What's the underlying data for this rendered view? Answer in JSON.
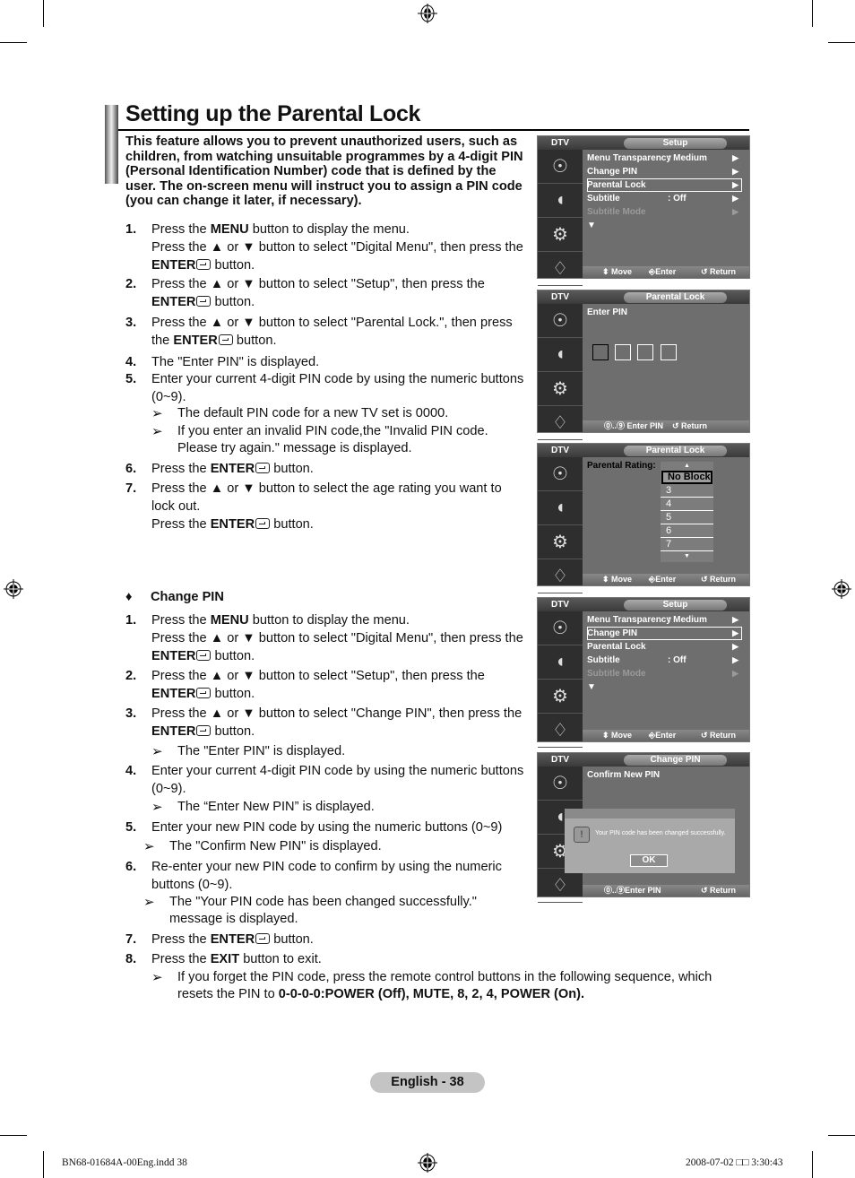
{
  "page": {
    "title": "Setting up the Parental Lock",
    "intro": "This feature allows you to prevent unauthorized users, such as children, from watching unsuitable programmes by a 4-digit PIN (Personal Identification Number) code that is defined by the user. The on-screen menu will instruct you to assign a PIN code (you can change it later, if necessary).",
    "page_label": "English - 38",
    "slug_left": "BN68-01684A-00Eng.indd   38",
    "slug_right": "2008-07-02   □□ 3:30:43"
  },
  "parental_steps": [
    {
      "num": "1.",
      "pre": "Press the ",
      "bold": "MENU",
      "post": " button to display the menu.",
      "line2": "Press the ▲ or ▼ button to select \"Digital Menu\", then press the",
      "enter": "ENTER",
      "tail": " button."
    },
    {
      "num": "2.",
      "line": "Press the ▲ or ▼ button to select \"Setup\", then press the",
      "enter": "ENTER",
      "tail": " button."
    },
    {
      "num": "3.",
      "line": "Press the ▲ or ▼ button to select \"Parental Lock.\", then press",
      "pre2": "the ",
      "enter": "ENTER",
      "tail": " button."
    },
    {
      "num": "4.",
      "line": "The \"Enter PIN\" is displayed."
    },
    {
      "num": "5.",
      "line": "Enter your current 4-digit PIN code by using the numeric buttons",
      "line2": "(0~9)."
    },
    {
      "num": "6.",
      "pre": "Press the ",
      "enter": "ENTER",
      "tail": " button."
    },
    {
      "num": "7.",
      "line": "Press the ▲ or ▼ button to select the age rating you want to",
      "line2": "lock out.",
      "pre3": "Press the ",
      "enter": "ENTER",
      "tail": " button."
    }
  ],
  "parental_notes": [
    "The default PIN code for a new TV set is 0000.",
    "If you enter an invalid PIN code,the \"Invalid PIN code.",
    "Please try again.\" message is displayed."
  ],
  "change_pin": {
    "bullet": "♦",
    "heading": "Change PIN",
    "steps": [
      {
        "num": "1.",
        "pre": "Press the ",
        "bold": "MENU",
        "post": " button to display the menu.",
        "line2": "Press the ▲ or ▼ button to select \"Digital Menu\", then press the",
        "enter": "ENTER",
        "tail": " button."
      },
      {
        "num": "2.",
        "line": "Press the ▲ or ▼ button to select \"Setup\", then press the",
        "enter": "ENTER",
        "tail": " button."
      },
      {
        "num": "3.",
        "line": "Press the ▲ or ▼ button to select \"Change PIN\", then press the",
        "enter": "ENTER",
        "tail": " button."
      },
      {
        "num": "4.",
        "line": "Enter your current 4-digit PIN code by using the numeric buttons",
        "line2": "(0~9)."
      },
      {
        "num": "5.",
        "line": "Enter your new PIN code by using the numeric buttons (0~9)"
      },
      {
        "num": "6.",
        "line": "Re-enter your new PIN code to confirm by using the numeric",
        "line2": "buttons (0~9)."
      },
      {
        "num": "7.",
        "pre": "Press the ",
        "enter": "ENTER",
        "tail": " button."
      },
      {
        "num": "8.",
        "pre": "Press the ",
        "bold": "EXIT",
        "post": " button to exit."
      }
    ],
    "notes": {
      "after3": "The \"Enter PIN\" is displayed.",
      "after4": "The “Enter New PIN” is displayed.",
      "after5": "The \"Confirm New PIN\" is displayed.",
      "after6a": "The \"Your PIN code has been changed successfully.\"",
      "after6b": "message is displayed.",
      "final_a": "If you forget the PIN code, press the remote control buttons in the following sequence, which",
      "final_b_pre": "resets the PIN to ",
      "final_b_bold": "0-0-0-0:POWER (Off), MUTE, 8, 2, 4, POWER (On)."
    }
  },
  "arrow_glyph": "➢",
  "screens": {
    "dtv_label": "DTV",
    "setup1": {
      "title": "Setup",
      "items": [
        {
          "label": "Menu Transparency",
          "value": ": Medium"
        },
        {
          "label": "Change PIN",
          "value": ""
        },
        {
          "label": "Parental Lock",
          "value": ""
        },
        {
          "label": "Subtitle",
          "value": ": Off"
        },
        {
          "label": "Subtitle Mode",
          "value": ""
        }
      ],
      "selected": "Parental Lock",
      "more": "▼",
      "footer": {
        "move": "⬍ Move",
        "enter": "⎆Enter",
        "return": "↺ Return"
      }
    },
    "enter_pin": {
      "title": "Parental Lock",
      "label": "Enter PIN",
      "footer": {
        "enter": "⓪..⑨ Enter PIN",
        "return": "↺ Return"
      }
    },
    "rating": {
      "title": "Parental Lock",
      "label": "Parental Rating:",
      "options": [
        "No Block",
        "3",
        "4",
        "5",
        "6",
        "7"
      ],
      "selected": "No Block",
      "footer": {
        "move": "⬍ Move",
        "enter": "⎆Enter",
        "return": "↺ Return"
      }
    },
    "setup2": {
      "title": "Setup",
      "selected": "Change PIN",
      "footer": {
        "move": "⬍ Move",
        "enter": "⎆Enter",
        "return": "↺ Return"
      }
    },
    "change_pin": {
      "title": "Change PIN",
      "label": "Confirm New PIN",
      "dialog_message": "Your PIN code has been changed successfully.",
      "ok": "OK",
      "footer": {
        "enter": "⓪..⑨Enter PIN",
        "return": "↺ Return"
      }
    },
    "side_icons": [
      "☉",
      "◖",
      "⚙",
      "♢"
    ]
  }
}
